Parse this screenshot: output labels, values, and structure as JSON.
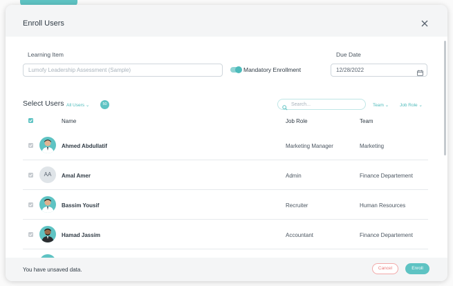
{
  "dialog": {
    "title": "Enroll Users",
    "close_icon": "close-icon"
  },
  "form": {
    "learning_item_label": "Learning Item",
    "learning_item_placeholder": "Lumofy Leadership Assessment (Sample)",
    "mandatory_label": "Mandatory Enrollment",
    "mandatory_on": true,
    "due_date_label": "Due Date",
    "due_date_value": "12/28/2022"
  },
  "select_users": {
    "title": "Select Users",
    "filter_label": "All Users",
    "count": "50",
    "search_placeholder": "Search...",
    "team_filter": "Team",
    "job_role_filter": "Job Role"
  },
  "table": {
    "columns": [
      "Name",
      "Job Role",
      "Team"
    ],
    "rows": [
      {
        "name": "Ahmed Abdullatif",
        "job_role": "Marketing Manager",
        "team": "Marketing",
        "avatar": "photo"
      },
      {
        "name": "Amal Amer",
        "job_role": "Admin",
        "team": "Finance Departement",
        "avatar": "initials",
        "initials": "AA"
      },
      {
        "name": "Bassim Yousif",
        "job_role": "Recruiter",
        "team": "Human Resources",
        "avatar": "photo"
      },
      {
        "name": "Hamad Jassim",
        "job_role": "Accountant",
        "team": "Finance Departement",
        "avatar": "photo"
      }
    ]
  },
  "footer": {
    "message": "You have unsaved data.",
    "cancel_label": "Cancel",
    "enroll_label": "Enroll"
  },
  "colors": {
    "accent": "#5ec3c3",
    "cancel": "#e87a7a"
  }
}
